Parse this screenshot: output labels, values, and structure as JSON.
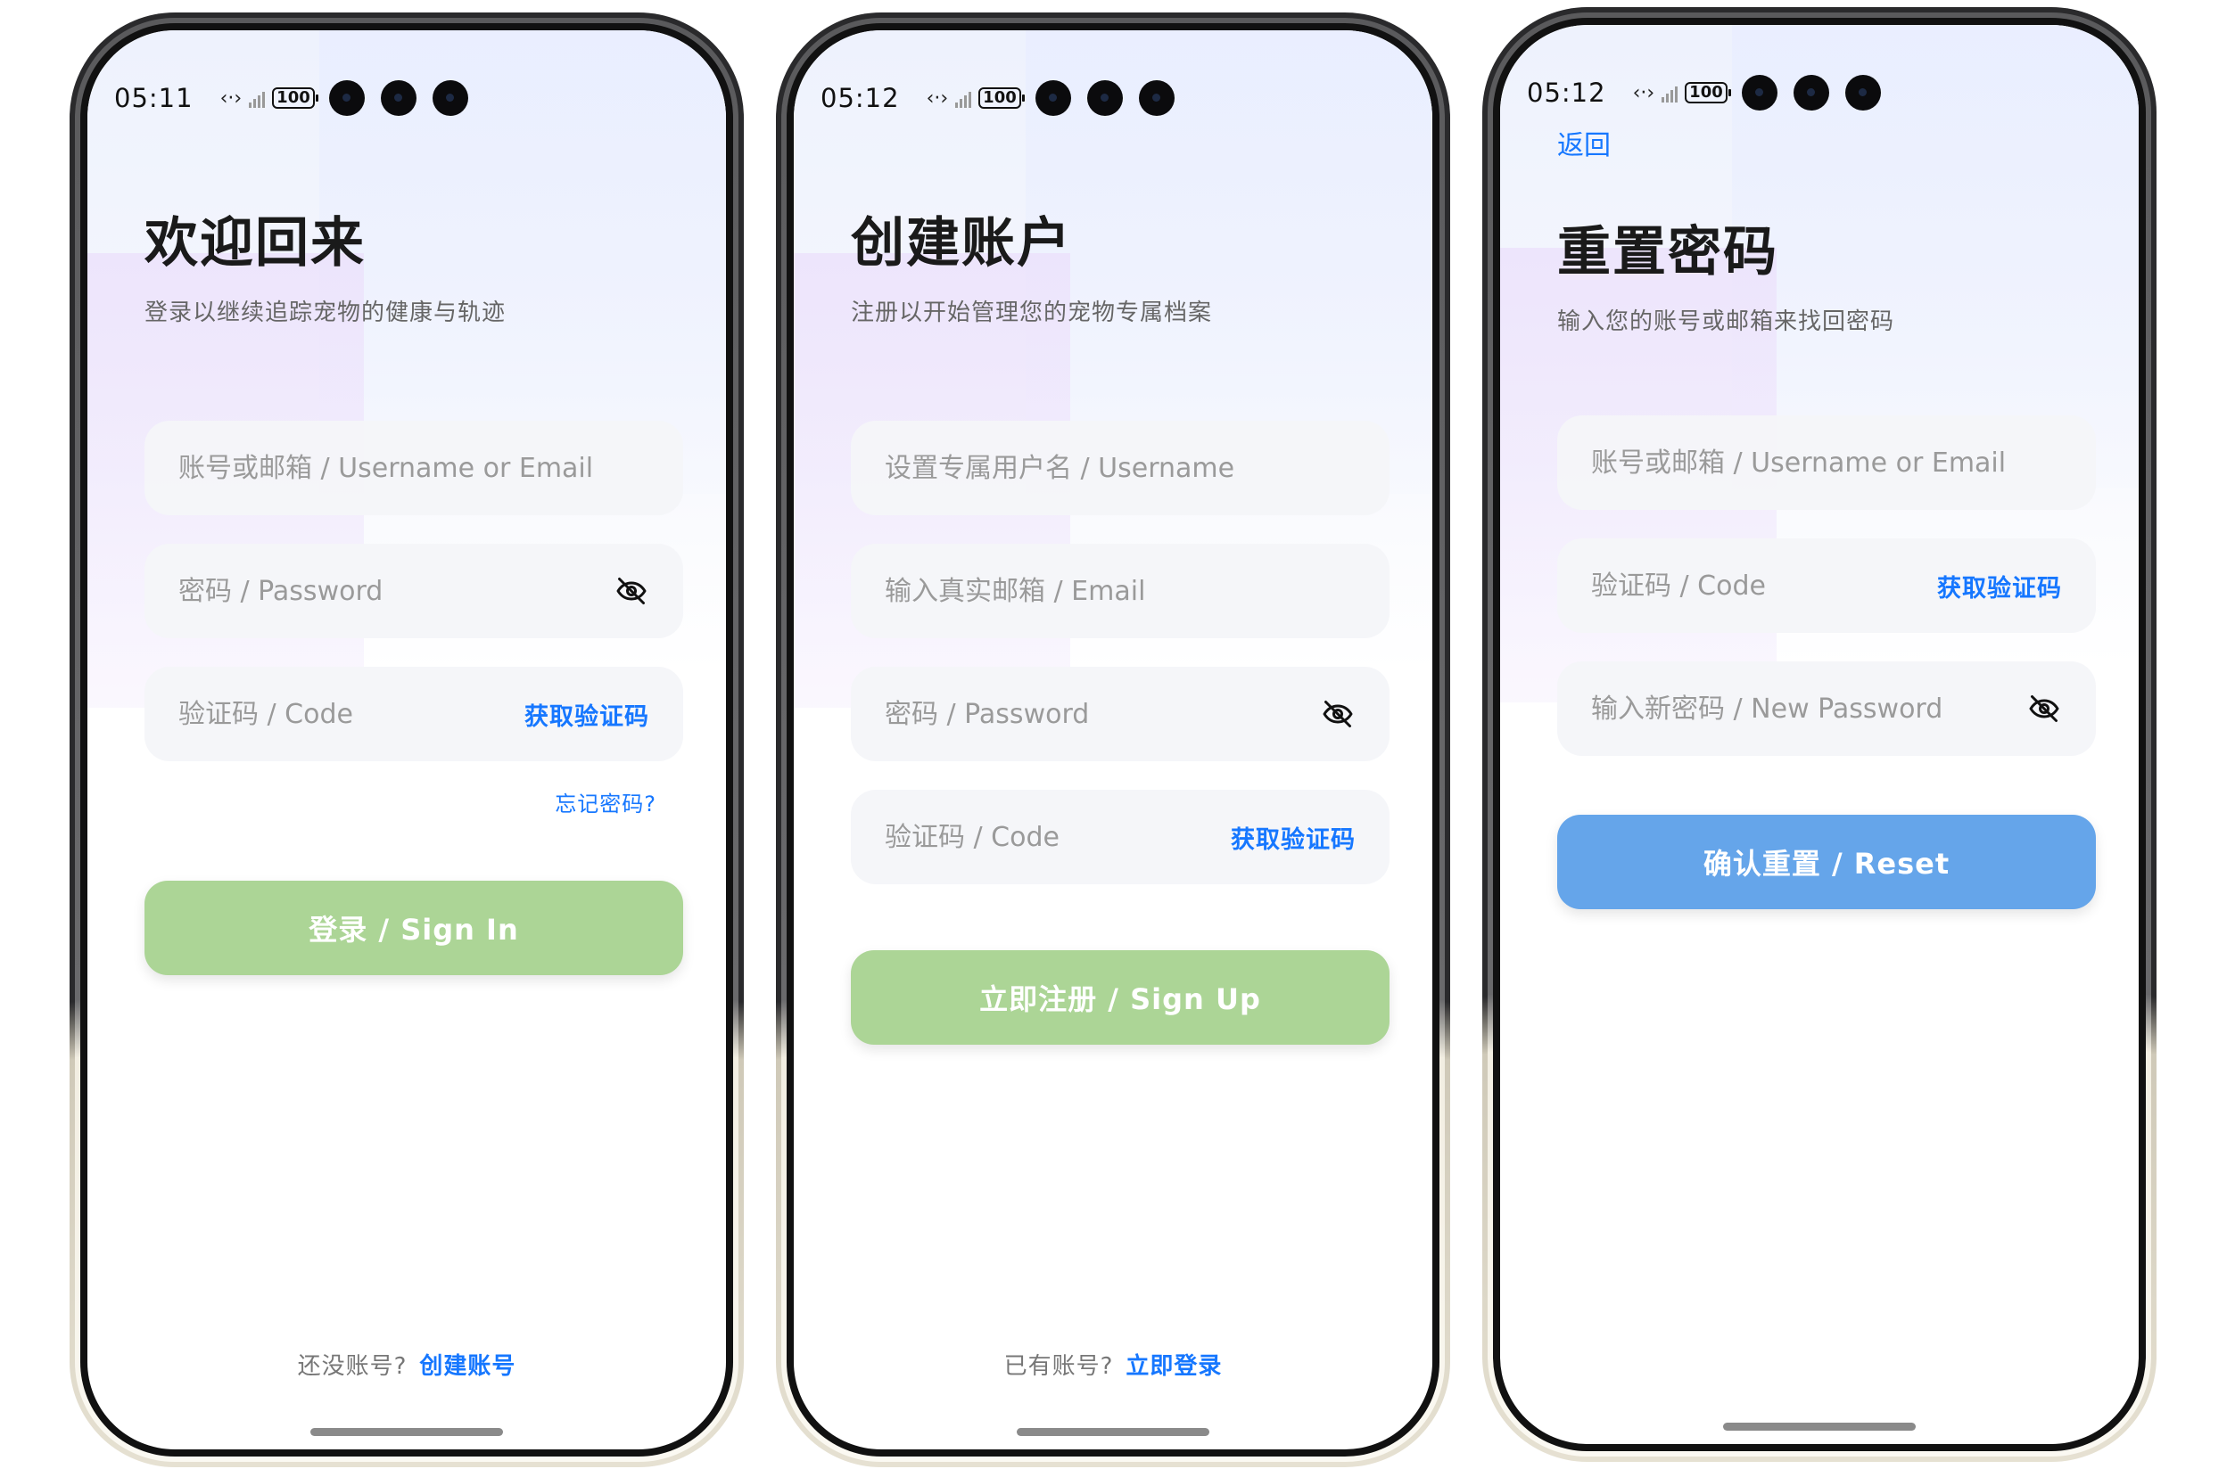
{
  "status_bar": {
    "battery": "100"
  },
  "login": {
    "time": "05:11",
    "title": "欢迎回来",
    "subtitle": "登录以继续追踪宠物的健康与轨迹",
    "username_placeholder": "账号或邮箱 / Username or Email",
    "password_placeholder": "密码 / Password",
    "code_placeholder": "验证码 / Code",
    "get_code": "获取验证码",
    "forgot_password": "忘记密码?",
    "submit": "登录 / Sign In",
    "prompt": "还没账号?",
    "link": "创建账号"
  },
  "register": {
    "time": "05:12",
    "title": "创建账户",
    "subtitle": "注册以开始管理您的宠物专属档案",
    "username_placeholder": "设置专属用户名 / Username",
    "email_placeholder": "输入真实邮箱 / Email",
    "password_placeholder": "密码 / Password",
    "code_placeholder": "验证码 / Code",
    "get_code": "获取验证码",
    "submit": "立即注册 / Sign Up",
    "prompt": "已有账号?",
    "link": "立即登录"
  },
  "reset": {
    "time": "05:12",
    "back": "返回",
    "title": "重置密码",
    "subtitle": "输入您的账号或邮箱来找回密码",
    "username_placeholder": "账号或邮箱 / Username or Email",
    "code_placeholder": "验证码 / Code",
    "get_code": "获取验证码",
    "new_password_placeholder": "输入新密码 / New Password",
    "submit": "确认重置 / Reset"
  },
  "colors": {
    "link_blue": "#1677ff",
    "button_green": "#acd596",
    "button_blue": "#65a5ea",
    "field_bg": "#f4f5f9",
    "title_text": "#1a1a1a"
  },
  "icons": {
    "password_toggle": "eye-off-icon",
    "network": "data-transfer-icon",
    "signal": "cell-signal-icon",
    "battery": "battery-icon",
    "camera": "camera-cutout-icon"
  }
}
